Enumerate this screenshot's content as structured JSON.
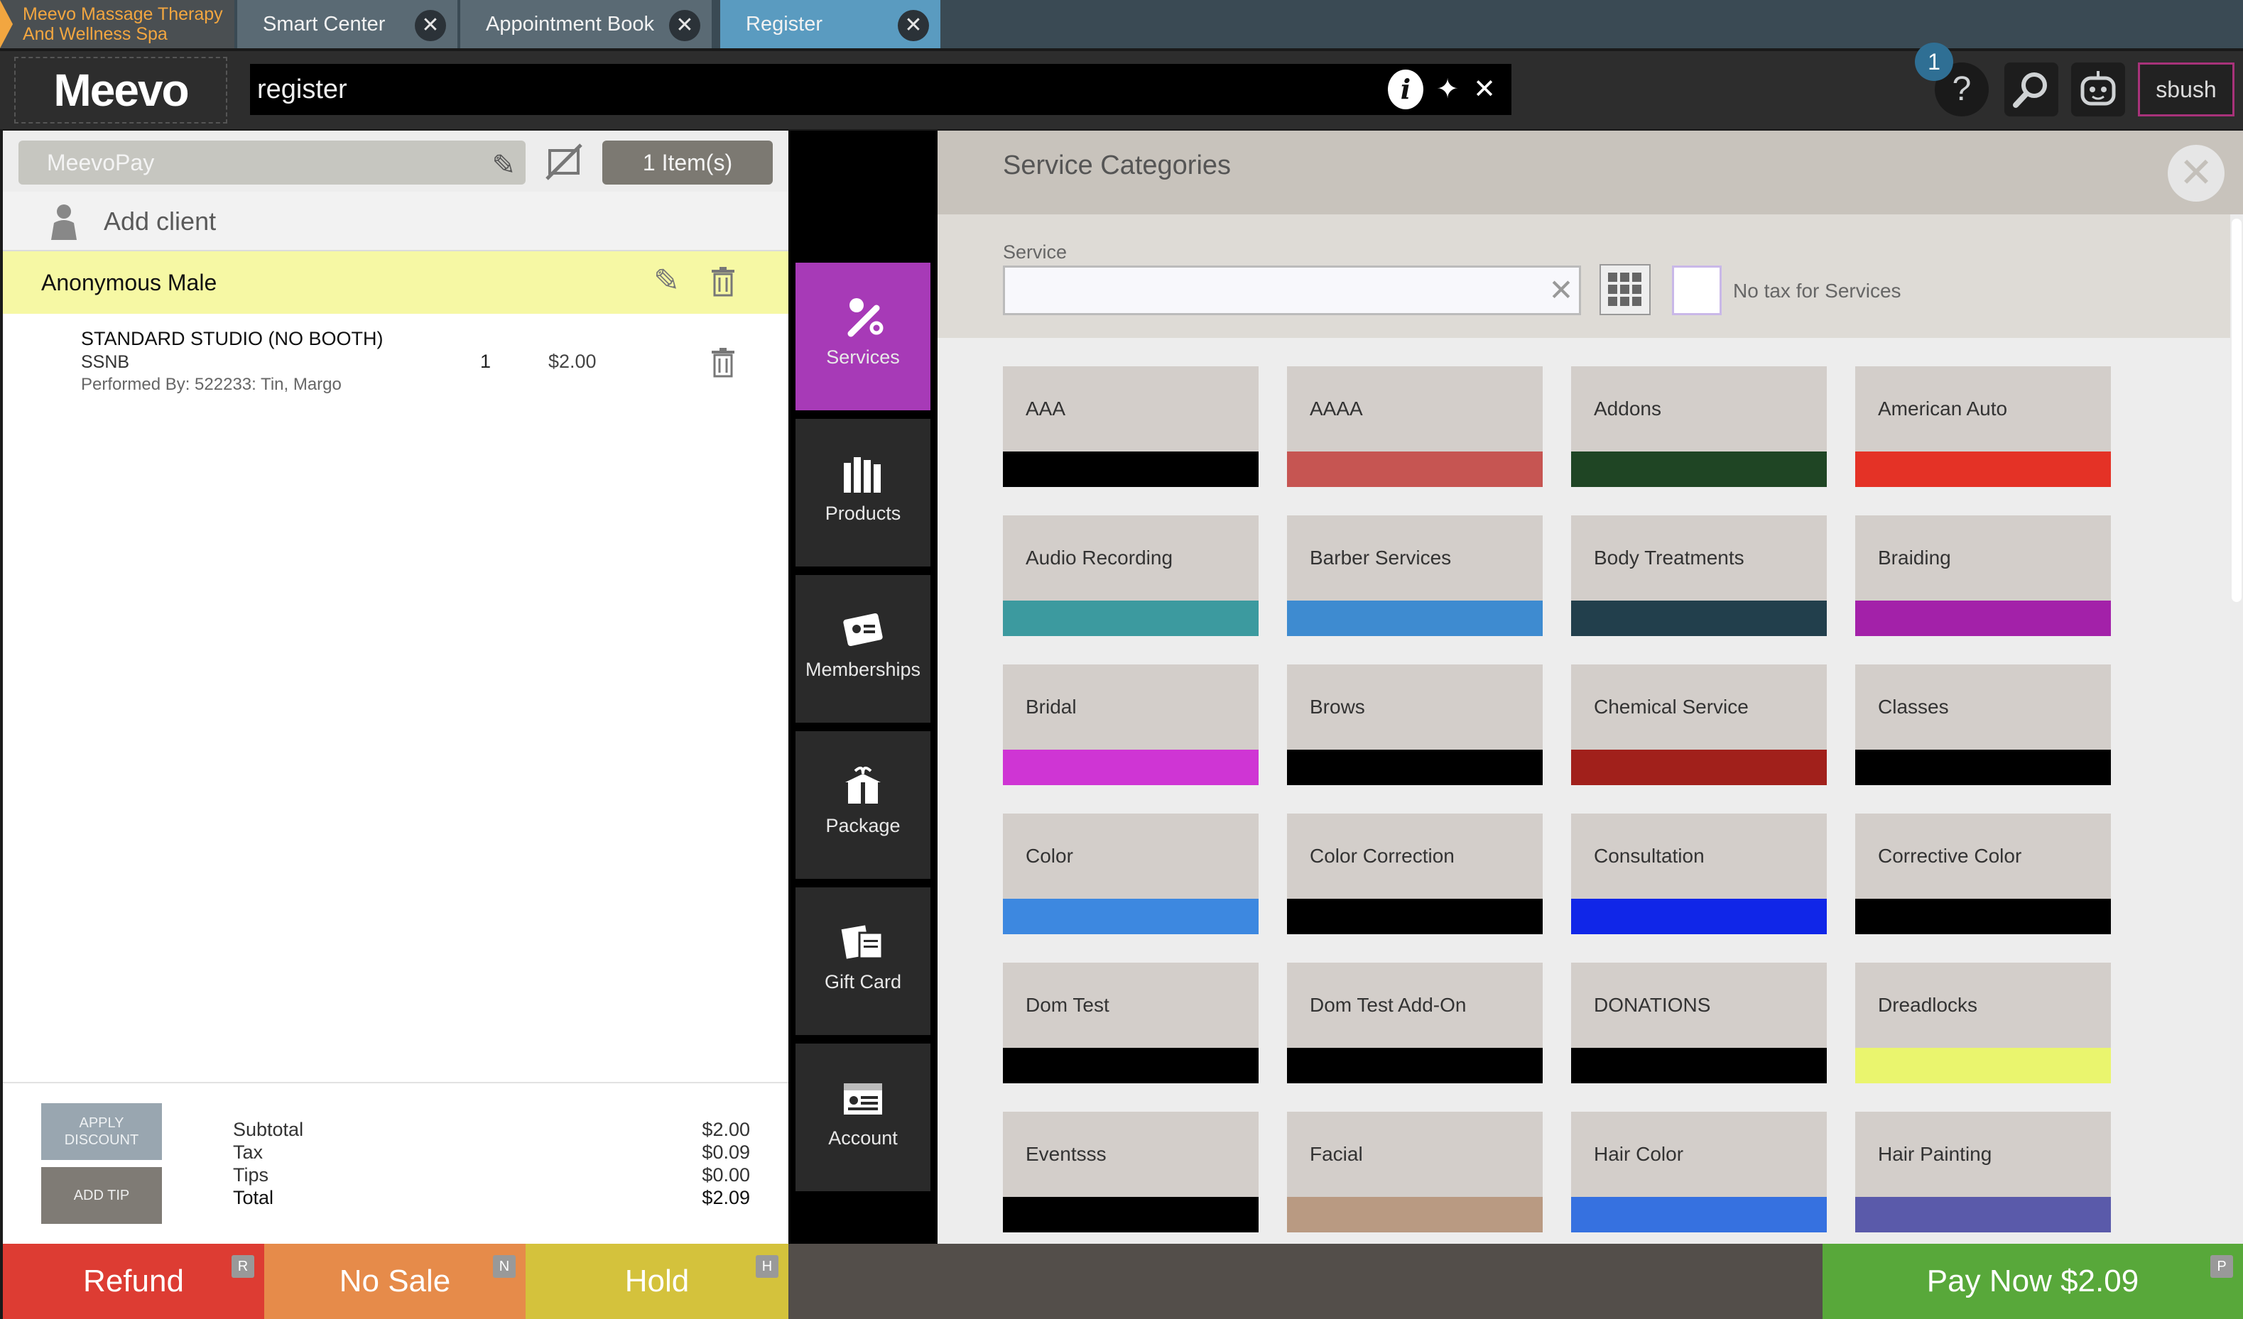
{
  "tabs": {
    "company": "Meevo Massage Therapy And Wellness Spa",
    "items": [
      {
        "label": "Smart Center"
      },
      {
        "label": "Appointment Book"
      },
      {
        "label": "Register"
      }
    ],
    "close_glyph": "✕"
  },
  "header": {
    "logo": "Meevo",
    "search_value": "register",
    "notifications": "1",
    "user": "sbush",
    "icons": [
      "info-icon",
      "sparkle-icon",
      "close-icon",
      "help-icon",
      "search-icon",
      "assistant-icon"
    ]
  },
  "ticket": {
    "payment_method": "MeevoPay",
    "items_count": "1 Item(s)",
    "add_client": "Add client",
    "client_name": "Anonymous Male",
    "lines": [
      {
        "title": "STANDARD STUDIO (NO BOOTH)",
        "code": "SSNB",
        "performed_by": "Performed By: 522233: Tin, Margo",
        "qty": "1",
        "price": "$2.00"
      }
    ],
    "apply_discount": "APPLY DISCOUNT",
    "add_tip": "ADD TIP",
    "totals": [
      {
        "label": "Subtotal",
        "value": "$2.00"
      },
      {
        "label": "Tax",
        "value": "$0.09"
      },
      {
        "label": "Tips",
        "value": "$0.00"
      },
      {
        "label": "Total",
        "value": "$2.09"
      }
    ]
  },
  "footer": {
    "refund": "Refund",
    "refund_key": "R",
    "nosale": "No Sale",
    "nosale_key": "N",
    "hold": "Hold",
    "hold_key": "H",
    "paynow": "Pay Now $2.09",
    "paynow_key": "P"
  },
  "nav": [
    {
      "label": "Services",
      "icon": "services-icon"
    },
    {
      "label": "Products",
      "icon": "products-icon"
    },
    {
      "label": "Memberships",
      "icon": "memberships-icon"
    },
    {
      "label": "Package",
      "icon": "package-icon"
    },
    {
      "label": "Gift Card",
      "icon": "gift-card-icon"
    },
    {
      "label": "Account",
      "icon": "account-icon"
    }
  ],
  "categories_panel": {
    "title": "Service Categories",
    "service_label": "Service",
    "service_value": "",
    "no_tax_label": "No tax for Services"
  },
  "categories": [
    {
      "name": "AAA",
      "color": "#000000"
    },
    {
      "name": "AAAA",
      "color": "#c65552"
    },
    {
      "name": "Addons",
      "color": "#1f4524"
    },
    {
      "name": "American Auto",
      "color": "#e43226"
    },
    {
      "name": "Audio Recording",
      "color": "#3c9a9f"
    },
    {
      "name": "Barber Services",
      "color": "#3e8bd0"
    },
    {
      "name": "Body Treatments",
      "color": "#223f4c"
    },
    {
      "name": "Braiding",
      "color": "#a321a9"
    },
    {
      "name": "Bridal",
      "color": "#cf35d4"
    },
    {
      "name": "Brows",
      "color": "#000000"
    },
    {
      "name": "Chemical Service",
      "color": "#a1201b"
    },
    {
      "name": "Classes",
      "color": "#000000"
    },
    {
      "name": "Color",
      "color": "#3d88e0"
    },
    {
      "name": "Color Correction",
      "color": "#000000"
    },
    {
      "name": "Consultation",
      "color": "#1026e8"
    },
    {
      "name": "Corrective Color",
      "color": "#000000"
    },
    {
      "name": "Dom Test",
      "color": "#000000"
    },
    {
      "name": "Dom Test Add-On",
      "color": "#000000"
    },
    {
      "name": "DONATIONS",
      "color": "#000000"
    },
    {
      "name": "Dreadlocks",
      "color": "#eaf56e"
    },
    {
      "name": "Eventsss",
      "color": "#000000"
    },
    {
      "name": "Facial",
      "color": "#b99a82"
    },
    {
      "name": "Hair Color",
      "color": "#3671e0"
    },
    {
      "name": "Hair Painting",
      "color": "#5a5aaa"
    }
  ]
}
